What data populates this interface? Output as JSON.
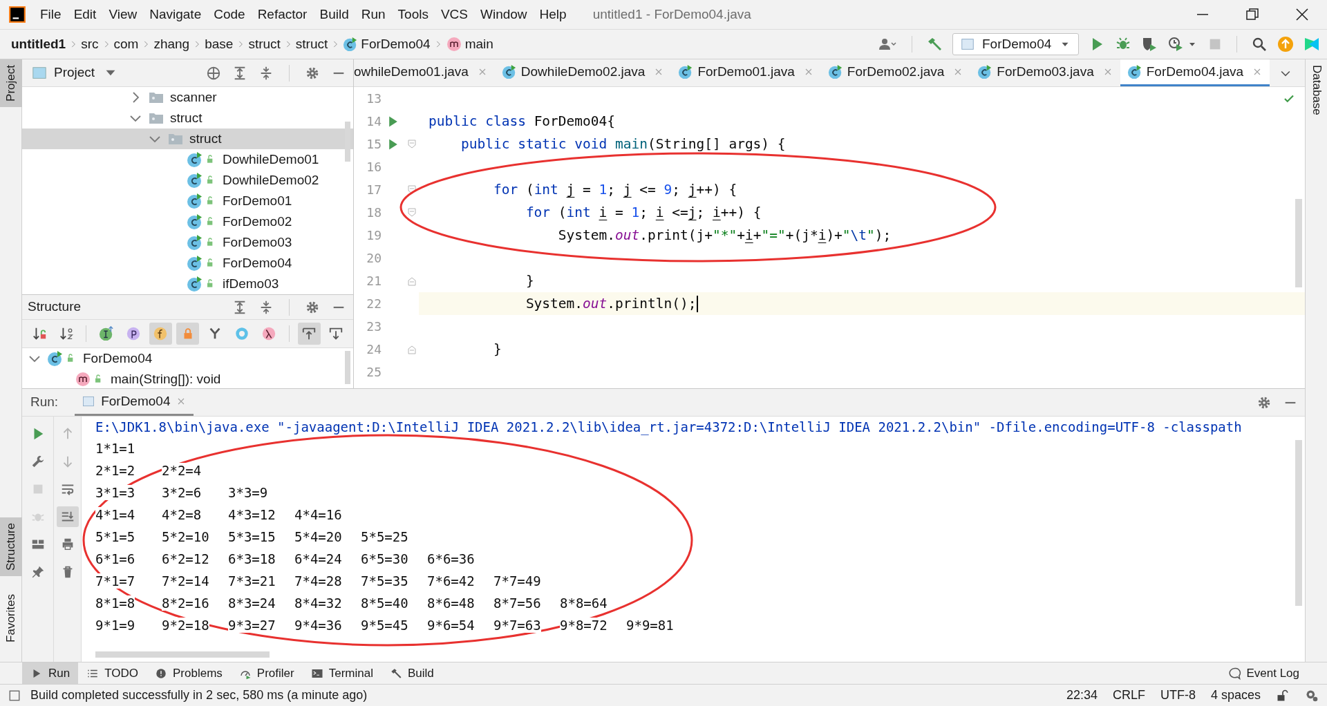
{
  "menu_bar": {
    "items": [
      "File",
      "Edit",
      "View",
      "Navigate",
      "Code",
      "Refactor",
      "Build",
      "Run",
      "Tools",
      "VCS",
      "Window",
      "Help"
    ],
    "title": "untitled1 - ForDemo04.java"
  },
  "breadcrumbs": [
    {
      "label": "untitled1",
      "kind": "project"
    },
    {
      "label": "src",
      "kind": "dir"
    },
    {
      "label": "com",
      "kind": "dir"
    },
    {
      "label": "zhang",
      "kind": "dir"
    },
    {
      "label": "base",
      "kind": "dir"
    },
    {
      "label": "struct",
      "kind": "dir"
    },
    {
      "label": "struct",
      "kind": "dir"
    },
    {
      "label": "ForDemo04",
      "kind": "class"
    },
    {
      "label": "main",
      "kind": "method"
    }
  ],
  "run_config": {
    "label": "ForDemo04"
  },
  "left_strip_top": [
    {
      "label": "Project",
      "selected": true
    }
  ],
  "left_strip_bottom": [
    {
      "label": "Structure",
      "selected": true
    },
    {
      "label": "Favorites",
      "selected": false
    }
  ],
  "right_strip": [
    {
      "label": "Database"
    }
  ],
  "project_panel": {
    "title": "Project",
    "tree": [
      {
        "label": "scanner",
        "kind": "folder",
        "expanded": false,
        "selected": false
      },
      {
        "label": "struct",
        "kind": "folder",
        "expanded": true,
        "selected": false,
        "children": [
          {
            "label": "struct",
            "kind": "folder",
            "expanded": true,
            "selected": true,
            "children": [
              {
                "label": "DowhileDemo01",
                "kind": "class",
                "selected": false
              },
              {
                "label": "DowhileDemo02",
                "kind": "class",
                "selected": false
              },
              {
                "label": "ForDemo01",
                "kind": "class",
                "selected": false
              },
              {
                "label": "ForDemo02",
                "kind": "class",
                "selected": false
              },
              {
                "label": "ForDemo03",
                "kind": "class",
                "selected": false
              },
              {
                "label": "ForDemo04",
                "kind": "class",
                "selected": false
              },
              {
                "label": "ifDemo03",
                "kind": "class",
                "selected": false
              }
            ]
          }
        ]
      }
    ]
  },
  "structure_panel": {
    "title": "Structure",
    "toolbar": [
      {
        "kind": "sort-visibility",
        "on": false
      },
      {
        "kind": "sort-alpha",
        "on": false
      },
      {
        "kind": "inherited",
        "on": false
      },
      {
        "kind": "properties",
        "on": false
      },
      {
        "kind": "fields",
        "on": true
      },
      {
        "kind": "non-public",
        "on": true
      },
      {
        "kind": "fork",
        "on": false
      },
      {
        "kind": "anonymous",
        "on": false
      },
      {
        "kind": "lambdas",
        "on": false
      },
      {
        "kind": "autoscroll-to",
        "on": true
      },
      {
        "kind": "autoscroll-from",
        "on": false
      }
    ],
    "tree": [
      {
        "label": "ForDemo04",
        "kind": "class",
        "expanded": true,
        "selected": false,
        "children": [
          {
            "label": "main(String[]): void",
            "kind": "method",
            "selected": false
          }
        ]
      }
    ]
  },
  "editor_tabs": [
    {
      "label": "owhileDemo01.java",
      "kind": "clipped",
      "selected": false
    },
    {
      "label": "DowhileDemo02.java",
      "kind": "class",
      "selected": false
    },
    {
      "label": "ForDemo01.java",
      "kind": "class",
      "selected": false
    },
    {
      "label": "ForDemo02.java",
      "kind": "class",
      "selected": false
    },
    {
      "label": "ForDemo03.java",
      "kind": "class",
      "selected": false
    },
    {
      "label": "ForDemo04.java",
      "kind": "class",
      "selected": true
    }
  ],
  "code_lines": [
    {
      "number": "13",
      "run_marker": false,
      "fold_start": false,
      "fold_end": false,
      "current": false
    },
    {
      "number": "14",
      "run_marker": true,
      "fold_start": false,
      "fold_end": false,
      "current": false,
      "tokens": [
        {
          "kind": "kw",
          "text": "public class "
        },
        {
          "kind": "plain",
          "text": "ForDemo04{"
        }
      ]
    },
    {
      "number": "15",
      "run_marker": true,
      "fold_start": true,
      "fold_end": false,
      "current": false,
      "tokens": [
        {
          "kind": "kw",
          "text": "    public static void "
        },
        {
          "kind": "method",
          "text": "main"
        },
        {
          "kind": "plain",
          "text": "(String[] args) {"
        }
      ]
    },
    {
      "number": "16",
      "run_marker": false,
      "fold_start": false,
      "fold_end": false,
      "current": false
    },
    {
      "number": "17",
      "run_marker": false,
      "fold_start": true,
      "fold_end": false,
      "current": false,
      "tokens": [
        {
          "kind": "kw",
          "text": "        for"
        },
        {
          "kind": "plain",
          "text": " ("
        },
        {
          "kind": "kw",
          "text": "int "
        },
        {
          "kind": "var",
          "text": "j"
        },
        {
          "kind": "plain",
          "text": " = "
        },
        {
          "kind": "num",
          "text": "1"
        },
        {
          "kind": "plain",
          "text": "; "
        },
        {
          "kind": "var",
          "text": "j"
        },
        {
          "kind": "plain",
          "text": " <= "
        },
        {
          "kind": "num",
          "text": "9"
        },
        {
          "kind": "plain",
          "text": "; "
        },
        {
          "kind": "var",
          "text": "j"
        },
        {
          "kind": "plain",
          "text": "++) {"
        }
      ]
    },
    {
      "number": "18",
      "run_marker": false,
      "fold_start": true,
      "fold_end": false,
      "current": false,
      "tokens": [
        {
          "kind": "kw",
          "text": "            for"
        },
        {
          "kind": "plain",
          "text": " ("
        },
        {
          "kind": "kw",
          "text": "int "
        },
        {
          "kind": "var",
          "text": "i"
        },
        {
          "kind": "plain",
          "text": " = "
        },
        {
          "kind": "num",
          "text": "1"
        },
        {
          "kind": "plain",
          "text": "; "
        },
        {
          "kind": "var",
          "text": "i"
        },
        {
          "kind": "plain",
          "text": " <="
        },
        {
          "kind": "var",
          "text": "j"
        },
        {
          "kind": "plain",
          "text": "; "
        },
        {
          "kind": "var",
          "text": "i"
        },
        {
          "kind": "plain",
          "text": "++) {"
        }
      ]
    },
    {
      "number": "19",
      "run_marker": false,
      "fold_start": false,
      "fold_end": false,
      "current": false,
      "tokens": [
        {
          "kind": "plain",
          "text": "                System."
        },
        {
          "kind": "field",
          "text": "out"
        },
        {
          "kind": "plain",
          "text": ".print(j+"
        },
        {
          "kind": "str",
          "text": "\"*\""
        },
        {
          "kind": "plain",
          "text": "+"
        },
        {
          "kind": "var",
          "text": "i"
        },
        {
          "kind": "plain",
          "text": "+"
        },
        {
          "kind": "str",
          "text": "\"=\""
        },
        {
          "kind": "plain",
          "text": "+(j*"
        },
        {
          "kind": "var",
          "text": "i"
        },
        {
          "kind": "plain",
          "text": ")+"
        },
        {
          "kind": "str",
          "text": "\""
        },
        {
          "kind": "esc",
          "text": "\\t"
        },
        {
          "kind": "str",
          "text": "\""
        },
        {
          "kind": "plain",
          "text": ");"
        }
      ]
    },
    {
      "number": "20",
      "run_marker": false,
      "fold_start": false,
      "fold_end": false,
      "current": false
    },
    {
      "number": "21",
      "run_marker": false,
      "fold_start": false,
      "fold_end": true,
      "current": false,
      "tokens": [
        {
          "kind": "plain",
          "text": "            }"
        }
      ]
    },
    {
      "number": "22",
      "run_marker": false,
      "fold_start": false,
      "fold_end": false,
      "current": true,
      "tokens": [
        {
          "kind": "plain",
          "text": "            System."
        },
        {
          "kind": "field",
          "text": "out"
        },
        {
          "kind": "plain",
          "text": ".println();"
        }
      ]
    },
    {
      "number": "23",
      "run_marker": false,
      "fold_start": false,
      "fold_end": false,
      "current": false
    },
    {
      "number": "24",
      "run_marker": false,
      "fold_start": false,
      "fold_end": true,
      "current": false,
      "tokens": [
        {
          "kind": "plain",
          "text": "        }"
        }
      ]
    },
    {
      "number": "25",
      "run_marker": false,
      "fold_start": false,
      "fold_end": false,
      "current": false
    }
  ],
  "run_panel": {
    "label": "Run:",
    "tab": {
      "label": "ForDemo04",
      "selected": true
    },
    "tools_left": [
      {
        "kind": "rerun",
        "disabled": false
      },
      {
        "kind": "wrench",
        "disabled": false
      },
      {
        "kind": "stop",
        "disabled": true
      },
      {
        "kind": "bug",
        "disabled": true
      },
      {
        "kind": "layout",
        "disabled": false
      },
      {
        "kind": "pin",
        "disabled": false
      }
    ],
    "tools_right": [
      {
        "kind": "up",
        "on": false
      },
      {
        "kind": "down",
        "on": false
      },
      {
        "kind": "wrap",
        "on": false
      },
      {
        "kind": "scroll-end",
        "on": true
      },
      {
        "kind": "print",
        "on": false
      },
      {
        "kind": "trash",
        "on": false
      }
    ],
    "command": "E:\\JDK1.8\\bin\\java.exe \"-javaagent:D:\\IntelliJ IDEA 2021.2.2\\lib\\idea_rt.jar=4372:D:\\IntelliJ IDEA 2021.2.2\\bin\" -Dfile.encoding=UTF-8 -classpath",
    "output": [
      [
        "1*1=1"
      ],
      [
        "2*1=2",
        "2*2=4"
      ],
      [
        "3*1=3",
        "3*2=6",
        "3*3=9"
      ],
      [
        "4*1=4",
        "4*2=8",
        "4*3=12",
        "4*4=16"
      ],
      [
        "5*1=5",
        "5*2=10",
        "5*3=15",
        "5*4=20",
        "5*5=25"
      ],
      [
        "6*1=6",
        "6*2=12",
        "6*3=18",
        "6*4=24",
        "6*5=30",
        "6*6=36"
      ],
      [
        "7*1=7",
        "7*2=14",
        "7*3=21",
        "7*4=28",
        "7*5=35",
        "7*6=42",
        "7*7=49"
      ],
      [
        "8*1=8",
        "8*2=16",
        "8*3=24",
        "8*4=32",
        "8*5=40",
        "8*6=48",
        "8*7=56",
        "8*8=64"
      ],
      [
        "9*1=9",
        "9*2=18",
        "9*3=27",
        "9*4=36",
        "9*5=45",
        "9*6=54",
        "9*7=63",
        "9*8=72",
        "9*9=81"
      ]
    ]
  },
  "bottom_tabs": [
    {
      "label": "Run",
      "kind": "run",
      "selected": true
    },
    {
      "label": "TODO",
      "kind": "todo",
      "selected": false
    },
    {
      "label": "Problems",
      "kind": "problems",
      "selected": false
    },
    {
      "label": "Profiler",
      "kind": "profiler",
      "selected": false
    },
    {
      "label": "Terminal",
      "kind": "terminal",
      "selected": false
    },
    {
      "label": "Build",
      "kind": "build",
      "selected": false
    }
  ],
  "event_log": "Event Log",
  "status_bar": {
    "message": "Build completed successfully in 2 sec, 580 ms (a minute ago)",
    "items": [
      "22:34",
      "CRLF",
      "UTF-8",
      "4 spaces"
    ]
  }
}
